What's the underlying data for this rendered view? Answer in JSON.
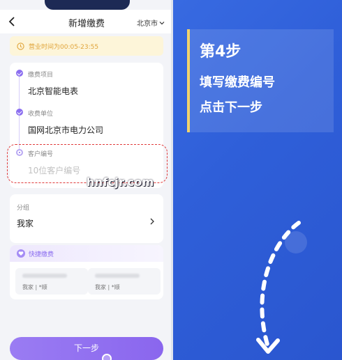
{
  "header": {
    "title": "新增缴费",
    "city": "北京市"
  },
  "notice": {
    "text": "营业时间为00:05-23:55"
  },
  "form": {
    "item_label": "缴费项目",
    "item_value": "北京智能电表",
    "unit_label": "收费单位",
    "unit_value": "国网北京市电力公司",
    "account_label": "客户编号",
    "account_placeholder": "10位客户编号"
  },
  "group": {
    "label": "分组",
    "value": "我家"
  },
  "quick": {
    "title": "快捷缴费",
    "items": [
      {
        "sub": "我家 | *顺"
      },
      {
        "sub": "我家 | *顺"
      }
    ]
  },
  "next_label": "下一步",
  "instruction": {
    "step": "第4步",
    "line1": "填写缴费编号",
    "line2": "点击下一步"
  },
  "watermark": "hnfcjr.com",
  "colors": {
    "accent": "#8c6ff0",
    "background": "#3f73e8",
    "highlight_bar": "#f2d36b",
    "dash": "#e03a3a"
  }
}
